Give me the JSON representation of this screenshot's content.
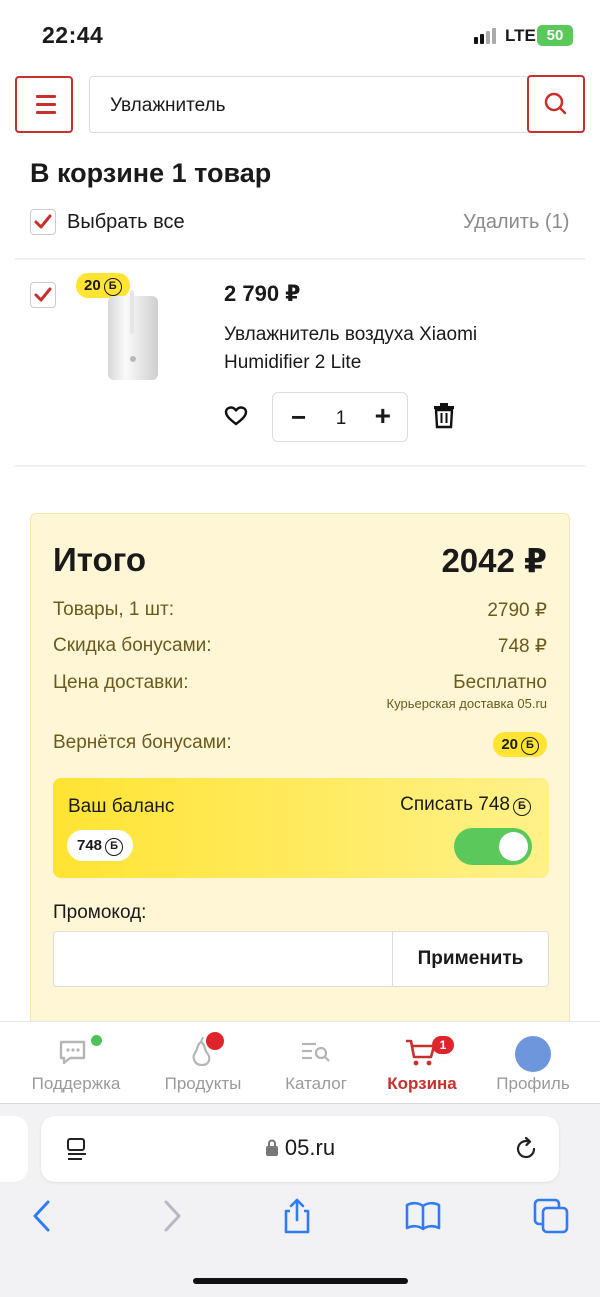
{
  "status_bar": {
    "time": "22:44",
    "network": "LTE",
    "battery": "50"
  },
  "search": {
    "query": "Увлажнитель"
  },
  "cart": {
    "title": "В корзине 1 товар",
    "select_all": "Выбрать все",
    "delete": "Удалить (1)",
    "items": [
      {
        "bonus": "20",
        "price": "2 790 ₽",
        "name": "Увлажнитель воздуха Xiaomi Humidifier 2 Lite",
        "quantity": "1",
        "checked": true
      }
    ]
  },
  "summary": {
    "total_label": "Итого",
    "total_value": "2042 ₽",
    "goods_label": "Товары, 1 шт:",
    "goods_value": "2790 ₽",
    "discount_label": "Скидка бонусами:",
    "discount_value": "748 ₽",
    "delivery_label": "Цена доставки:",
    "delivery_value": "Бесплатно",
    "delivery_note": "Курьерская доставка 05.ru",
    "return_label": "Вернётся бонусами:",
    "return_value": "20",
    "balance_label": "Ваш баланс",
    "balance_value": "748",
    "spend_label": "Списать 748",
    "spend_toggle_on": true,
    "promo_label": "Промокод:",
    "promo_value": "",
    "promo_button": "Применить"
  },
  "tabbar": {
    "items": [
      {
        "label": "Поддержка",
        "icon": "chat-icon"
      },
      {
        "label": "Продукты",
        "icon": "pear-icon"
      },
      {
        "label": "Каталог",
        "icon": "catalog-search-icon"
      },
      {
        "label": "Корзина",
        "icon": "cart-icon",
        "badge": "1",
        "active": true
      },
      {
        "label": "Профиль",
        "icon": "avatar-icon"
      }
    ]
  },
  "browser": {
    "url": "05.ru"
  },
  "coin_glyph": "Б",
  "colors": {
    "accent": "#c9302c",
    "bonus": "#ffe433",
    "toggle": "#5ac85a",
    "summary_bg": "#fff6d6"
  }
}
